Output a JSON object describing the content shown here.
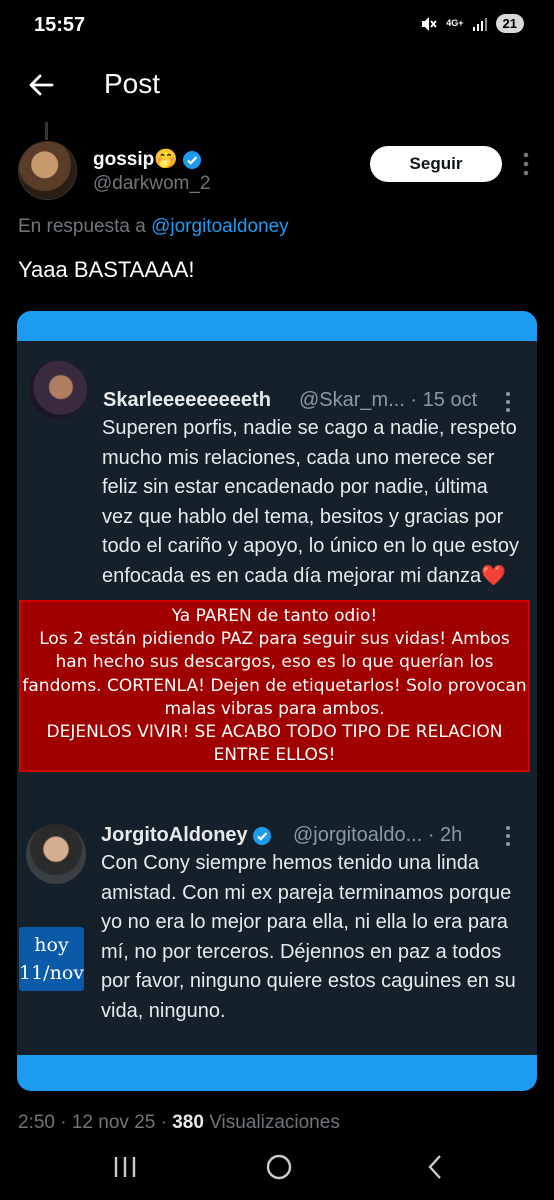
{
  "status_bar": {
    "time": "15:57",
    "network": "4G+",
    "battery": "21"
  },
  "header": {
    "title": "Post"
  },
  "post": {
    "author_name": "gossip🤭",
    "author_handle": "@darkwom_2",
    "follow_label": "Seguir",
    "reply_prefix": "En respuesta a",
    "reply_handle": "@jorgitoaldoney",
    "text": "Yaaa BASTAAAA!",
    "meta_time": "2:50 · 12 nov 25 ·",
    "views_count": "380",
    "views_label": "Visualizaciones"
  },
  "embedded": {
    "post1": {
      "name": "Skarleeeeeeeeeth",
      "meta": "@Skar_m... · 15 oct",
      "text": "Superen porfis, nadie se cago a nadie, respeto mucho mis relaciones, cada uno merece ser feliz sin estar encadenado por nadie, última vez que hablo del tema, besitos y gracias por todo el cariño y apoyo, lo único en lo que estoy enfocada es en cada día mejorar mi danza❤️"
    },
    "banner": {
      "line1": "Ya PAREN de tanto odio!",
      "line2": "Los 2 están pidiendo PAZ para seguir sus vidas! Ambos han hecho sus descargos, eso es lo que querían los fandoms. CORTENLA! Dejen de etiquetarlos! Solo provocan malas vibras para ambos.",
      "line3": "DEJENLOS VIVIR! SE ACABO TODO TIPO DE RELACION ENTRE ELLOS!"
    },
    "post2": {
      "name": "JorgitoAldoney",
      "meta": "@jorgitoaldo... · 2h",
      "text": "Con Cony siempre hemos tenido una linda amistad. Con mi ex pareja terminamos porque yo no era lo mejor para ella, ni ella lo era para mí, no por terceros. Déjennos en paz a todos por favor, ninguno quiere estos caguines en su vida, ninguno."
    },
    "sticker": {
      "line1": "hoy",
      "line2": "11/nov"
    }
  },
  "colors": {
    "accent": "#1d9bf0",
    "banner": "#a00000",
    "card": "#15202b"
  },
  "icons": [
    "back-arrow-icon",
    "verified-badge-icon",
    "more-options-icon",
    "recents-icon",
    "home-icon",
    "back-nav-icon"
  ]
}
